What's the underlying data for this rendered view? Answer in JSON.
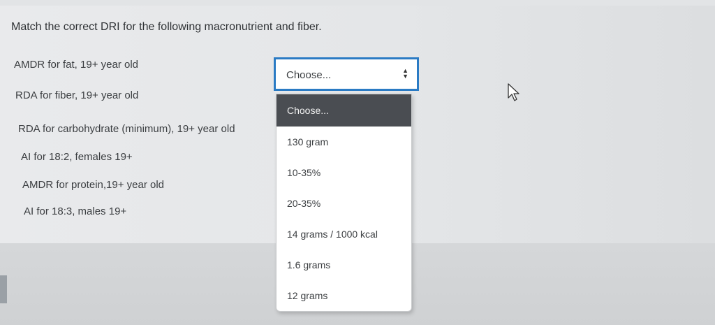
{
  "question": {
    "text": "Match the correct DRI for the following macronutrient and fiber."
  },
  "prompts": [
    "AMDR for fat, 19+ year old",
    "RDA for fiber, 19+ year old",
    "RDA for carbohydrate (minimum), 19+ year old",
    "AI for 18:2, females 19+",
    "AMDR for protein,19+ year old",
    "AI for 18:3, males 19+"
  ],
  "select": {
    "selected_value": "Choose...",
    "arrow_icon": "up-down-arrows-icon"
  },
  "dropdown": {
    "options": [
      "Choose...",
      "130 gram",
      "10-35%",
      "20-35%",
      "14 grams / 1000 kcal",
      "1.6 grams",
      "12 grams"
    ],
    "highlighted_index": 0
  },
  "colors": {
    "accent": "#2b7bc4",
    "highlight": "#4a4d52"
  }
}
